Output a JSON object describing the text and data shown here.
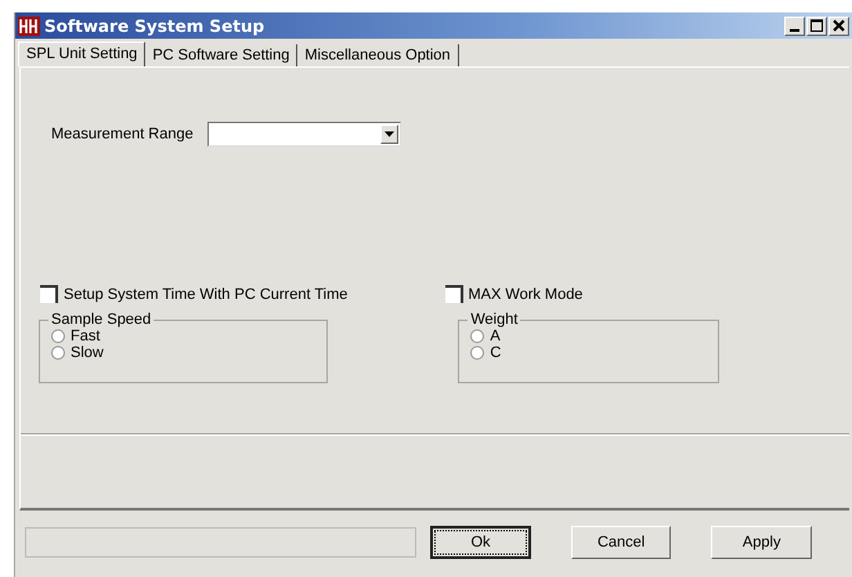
{
  "window": {
    "title": "Software System Setup"
  },
  "tabs": [
    {
      "label": "SPL Unit Setting",
      "selected": true
    },
    {
      "label": "PC Software Setting",
      "selected": false
    },
    {
      "label": "Miscellaneous Option",
      "selected": false
    }
  ],
  "measurement_range": {
    "label": "Measurement Range"
  },
  "checkboxes": [
    {
      "label": "Setup System Time With PC Current Time",
      "checked": false
    },
    {
      "label": "MAX Work Mode",
      "checked": false
    }
  ],
  "groups": [
    {
      "title": "Sample Speed",
      "options": [
        {
          "label": "Fast",
          "selected": false
        },
        {
          "label": "Slow",
          "selected": false
        }
      ]
    },
    {
      "title": "Weight",
      "options": [
        {
          "label": "A",
          "selected": false
        },
        {
          "label": "C",
          "selected": false
        }
      ]
    }
  ],
  "buttons": [
    {
      "label": "Ok",
      "default": true
    },
    {
      "label": "Cancel",
      "default": false
    },
    {
      "label": "Apply",
      "default": false
    }
  ]
}
